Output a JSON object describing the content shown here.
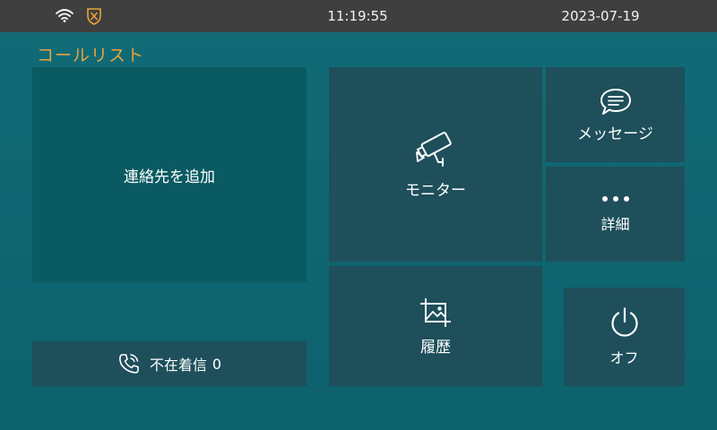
{
  "status": {
    "time": "11:19:55",
    "date": "2023-07-19",
    "icons": [
      "wifi-icon",
      "shield-icon"
    ]
  },
  "call_list": {
    "title": "コールリスト",
    "add_contact_label": "連絡先を追加",
    "missed_label": "不在着信",
    "missed_count": "0"
  },
  "tiles": {
    "monitor": "モニター",
    "message": "メッセージ",
    "details": "詳細",
    "history": "履歴",
    "off": "オフ"
  },
  "colors": {
    "background": "#116b77",
    "tile": "#1e4f5b",
    "add_contact_tile": "#0a5a62",
    "status_bar": "#3f3f3f",
    "accent": "#e8a33a"
  }
}
